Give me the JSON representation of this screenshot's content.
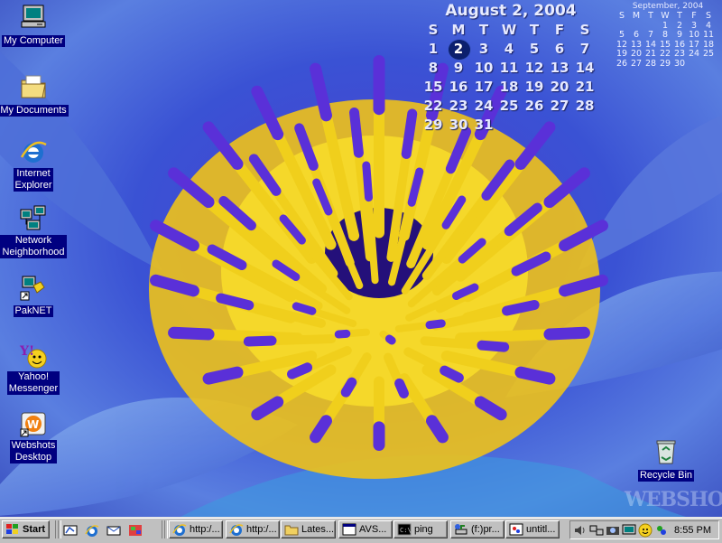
{
  "desktop": {
    "icons": [
      {
        "label": "My Computer",
        "icon": "my-computer-icon"
      },
      {
        "label": "My Documents",
        "icon": "my-documents-icon"
      },
      {
        "label": "Internet\nExplorer",
        "icon": "internet-explorer-icon"
      },
      {
        "label": "Network\nNeighborhood",
        "icon": "network-neighborhood-icon"
      },
      {
        "label": "PakNET",
        "icon": "paknet-icon"
      },
      {
        "label": "Yahoo!\nMessenger",
        "icon": "yahoo-messenger-icon"
      },
      {
        "label": "Webshots\nDesktop",
        "icon": "webshots-icon"
      },
      {
        "label": "Recycle Bin",
        "icon": "recycle-bin-icon"
      }
    ],
    "watermark": "WEBSHOTS"
  },
  "calendar_big": {
    "title": "August 2, 2004",
    "weekdays": [
      "S",
      "M",
      "T",
      "W",
      "T",
      "F",
      "S"
    ],
    "days": [
      "1",
      "2",
      "3",
      "4",
      "5",
      "6",
      "7",
      "8",
      "9",
      "10",
      "11",
      "12",
      "13",
      "14",
      "15",
      "16",
      "17",
      "18",
      "19",
      "20",
      "21",
      "22",
      "23",
      "24",
      "25",
      "26",
      "27",
      "28",
      "29",
      "30",
      "31"
    ],
    "today": "2"
  },
  "calendar_small": {
    "title": "September, 2004",
    "weekdays": [
      "S",
      "M",
      "T",
      "W",
      "T",
      "F",
      "S"
    ],
    "leading_blanks": 3,
    "days": [
      "1",
      "2",
      "3",
      "4",
      "5",
      "6",
      "7",
      "8",
      "9",
      "10",
      "11",
      "12",
      "13",
      "14",
      "15",
      "16",
      "17",
      "18",
      "19",
      "20",
      "21",
      "22",
      "23",
      "24",
      "25",
      "26",
      "27",
      "28",
      "29",
      "30"
    ]
  },
  "taskbar": {
    "start_label": "Start",
    "quick_launch": [
      "show-desktop-icon",
      "internet-explorer-icon",
      "outlook-express-icon",
      "media-icon"
    ],
    "tasks": [
      {
        "label": "http:/...",
        "icon": "internet-explorer-icon"
      },
      {
        "label": "http:/...",
        "icon": "internet-explorer-icon"
      },
      {
        "label": "Lates...",
        "icon": "folder-icon"
      },
      {
        "label": "AVS...",
        "icon": "app-icon"
      },
      {
        "label": "ping",
        "icon": "ping-icon"
      },
      {
        "label": "(f:)pr...",
        "icon": "network-drive-icon"
      },
      {
        "label": "untitl...",
        "icon": "paint-icon"
      }
    ],
    "tray_icons": [
      "volume-icon",
      "network-icon",
      "camera-icon",
      "monitor-icon",
      "yahoo-smiley-icon",
      "messenger-icon"
    ],
    "clock": "8:55 PM"
  },
  "colors": {
    "taskbar": "#c0c0c0",
    "icon_label_bg": "#000080",
    "flower_yellow": "#f2d21a",
    "petal_purple": "#5a35d8",
    "background_blue": "#2a3fb0"
  }
}
